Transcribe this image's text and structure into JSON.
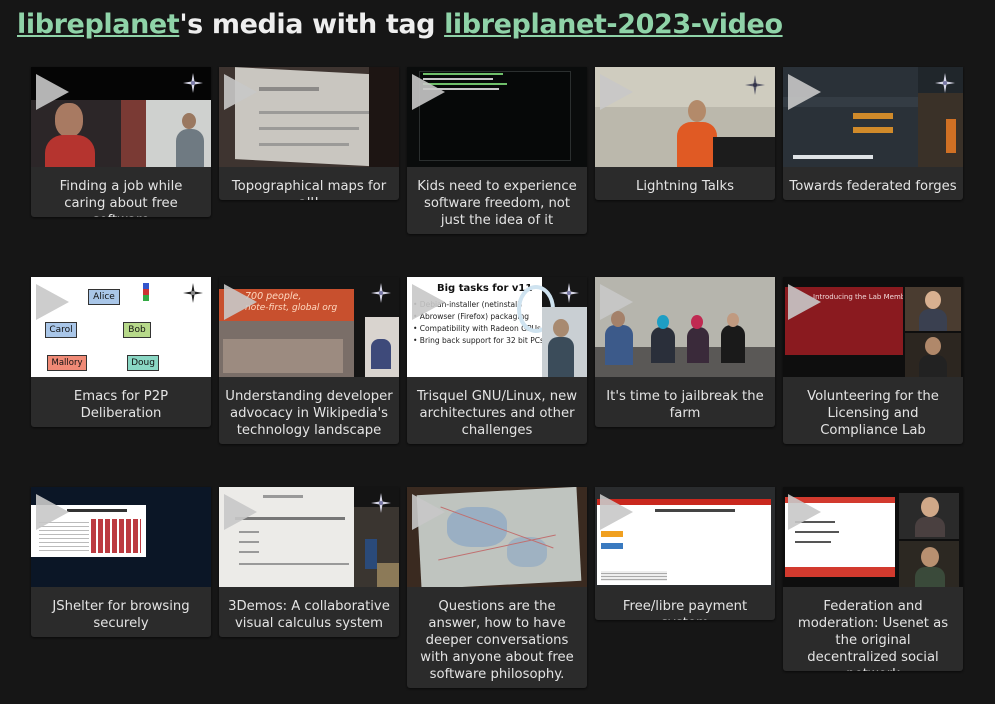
{
  "header": {
    "user_link": "libreplanet",
    "middle_text": "'s media with tag ",
    "tag_link": "libreplanet-2023-video"
  },
  "colors": {
    "background": "#161616",
    "card": "#2b2b2b",
    "link": "#8fd3a8",
    "text": "#e4e4e4"
  },
  "media": [
    {
      "title": "Finding a job while caring about free software"
    },
    {
      "title": "Topographical maps for all!"
    },
    {
      "title": "Kids need to experience software freedom, not just the idea of it"
    },
    {
      "title": "Lightning Talks"
    },
    {
      "title": "Towards federated forges"
    },
    {
      "title": "Emacs for P2P Deliberation",
      "thumb_text": [
        "Alice",
        "Carol",
        "Bob",
        "Mallory",
        "Doug"
      ]
    },
    {
      "title": "Understanding developer advocacy in Wikipedia's technology landscape",
      "thumb_text": [
        "700 people,",
        "note-first, global org"
      ]
    },
    {
      "title": "Trisquel GNU/Linux, new architectures and other challenges",
      "thumb_text": [
        "Big tasks for v11",
        "• Debian-installer (netinstall)",
        "• Abrowser (Firefox) packaging",
        "• Compatibility with Radeon GPUs",
        "• Bring back support for 32 bit PCs"
      ]
    },
    {
      "title": "It's time to jailbreak the farm"
    },
    {
      "title": "Volunteering for the Licensing and Compliance Lab",
      "thumb_text": [
        "Introducing the Lab Members"
      ]
    },
    {
      "title": "JShelter for browsing securely"
    },
    {
      "title": "3Demos: A collaborative visual calculus system"
    },
    {
      "title": "Questions are the answer, how to have deeper conversations with anyone about free software philosophy."
    },
    {
      "title": "Free/libre payment system"
    },
    {
      "title": "Federation and moderation: Usenet as the original decentralized social network"
    }
  ]
}
